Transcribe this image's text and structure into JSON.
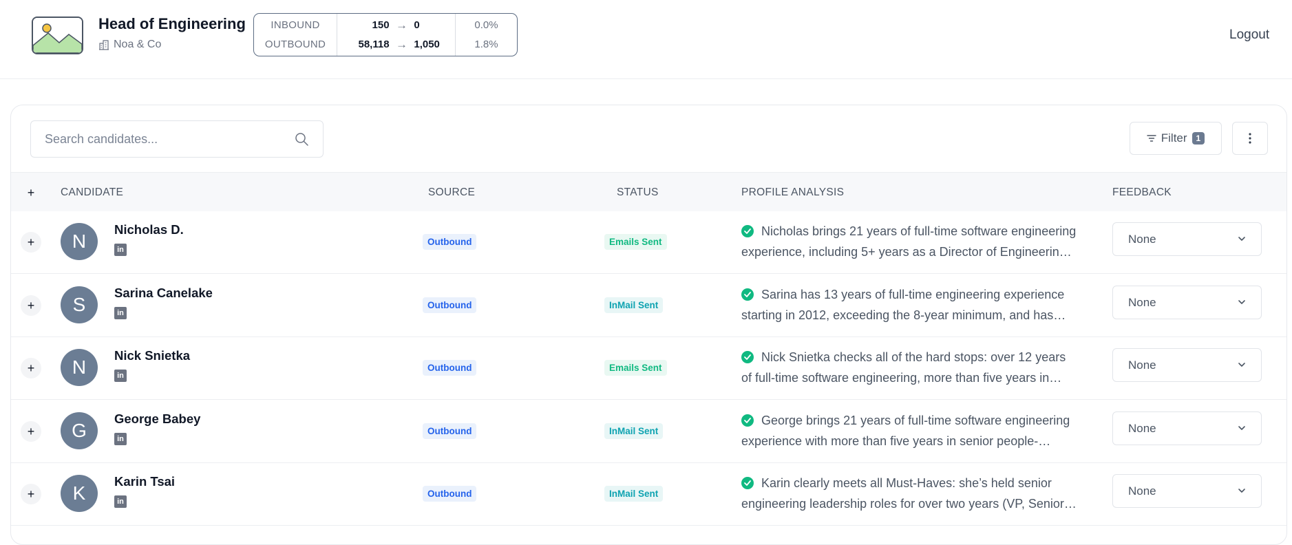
{
  "header": {
    "job_title": "Head of Engineering",
    "company": "Noa & Co",
    "logout_label": "Logout",
    "stats": {
      "inbound_label": "INBOUND",
      "outbound_label": "OUTBOUND",
      "inbound_from": "150",
      "inbound_to": "0",
      "inbound_pct": "0.0%",
      "outbound_from": "58,118",
      "outbound_to": "1,050",
      "outbound_pct": "1.8%",
      "arrow": "→"
    }
  },
  "toolbar": {
    "search_placeholder": "Search candidates...",
    "filter_label": "Filter",
    "filter_count": "1"
  },
  "table": {
    "expand_all": "+",
    "headers": {
      "candidate": "CANDIDATE",
      "source": "SOURCE",
      "status": "STATUS",
      "analysis": "PROFILE ANALYSIS",
      "feedback": "FEEDBACK"
    },
    "rows": [
      {
        "initial": "N",
        "name": "Nicholas D.",
        "source": "Outbound",
        "status": "Emails Sent",
        "analysis_1": "Nicholas brings 21 years of full-time software engineering",
        "analysis_2": "experience, including 5+ years as a Director of Engineerin…",
        "feedback": "None"
      },
      {
        "initial": "S",
        "name": "Sarina Canelake",
        "source": "Outbound",
        "status": "InMail Sent",
        "analysis_1": "Sarina has 13 years of full-time engineering experience",
        "analysis_2": "starting in 2012, exceeding the 8-year minimum, and has…",
        "feedback": "None"
      },
      {
        "initial": "N",
        "name": "Nick Snietka",
        "source": "Outbound",
        "status": "Emails Sent",
        "analysis_1": "Nick Snietka checks all of the hard stops: over 12 years",
        "analysis_2": "of full-time software engineering, more than five years in…",
        "feedback": "None"
      },
      {
        "initial": "G",
        "name": "George Babey",
        "source": "Outbound",
        "status": "InMail Sent",
        "analysis_1": "George brings 21 years of full-time software engineering",
        "analysis_2": "experience with more than five years in senior people-…",
        "feedback": "None"
      },
      {
        "initial": "K",
        "name": "Karin Tsai",
        "source": "Outbound",
        "status": "InMail Sent",
        "analysis_1": "Karin clearly meets all Must-Haves: she’s held senior",
        "analysis_2": "engineering leadership roles for over two years (VP, Senior…",
        "feedback": "None"
      }
    ]
  },
  "icons": {
    "logo": "image-placeholder-icon",
    "company": "building-icon",
    "search": "search-icon",
    "filter": "filter-lines-icon",
    "more": "more-vertical-icon",
    "linkedin": "linkedin-icon",
    "check": "check-circle-icon",
    "dropdown": "chevron-down-icon"
  },
  "colors": {
    "source_badge_text": "#2563eb",
    "emails_sent": "#10b981",
    "inmail_sent": "#0fa3b1",
    "avatar": "#6b7d94",
    "check": "#10b981"
  }
}
